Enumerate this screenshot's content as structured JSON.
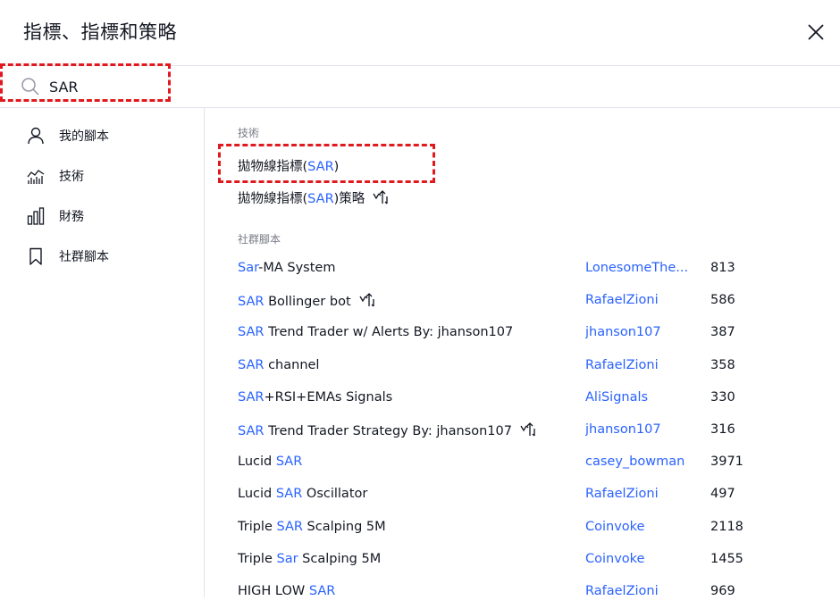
{
  "header": {
    "title": "指標、指標和策略"
  },
  "search": {
    "value": "SAR"
  },
  "sidebar": {
    "items": [
      {
        "label": "我的腳本",
        "icon": "user-icon"
      },
      {
        "label": "技術",
        "icon": "chart-icon"
      },
      {
        "label": "財務",
        "icon": "bar-chart-icon"
      },
      {
        "label": "社群腳本",
        "icon": "bookmark-icon"
      }
    ]
  },
  "technical": {
    "section_title": "技術",
    "items": [
      {
        "pre": "拋物線指標(",
        "match": "SAR",
        "post": ")"
      },
      {
        "pre": "拋物線指標(",
        "match": "SAR",
        "post": ")策略",
        "strategy": true
      }
    ]
  },
  "community": {
    "section_title": "社群腳本",
    "rows": [
      {
        "pre": "",
        "match": "Sar",
        "post": "-MA System",
        "author": "LonesomeThe...",
        "count": "813"
      },
      {
        "pre": "",
        "match": "SAR",
        "post": " Bollinger bot",
        "strategy": true,
        "author": "RafaelZioni",
        "count": "586"
      },
      {
        "pre": "",
        "match": "SAR",
        "post": " Trend Trader w/ Alerts By: jhanson107",
        "author": "jhanson107",
        "count": "387"
      },
      {
        "pre": "",
        "match": "SAR",
        "post": " channel",
        "author": "RafaelZioni",
        "count": "358"
      },
      {
        "pre": "",
        "match": "SAR",
        "post": "+RSI+EMAs Signals",
        "author": "AliSignals",
        "count": "330"
      },
      {
        "pre": "",
        "match": "SAR",
        "post": " Trend Trader Strategy By: jhanson107",
        "strategy": true,
        "author": "jhanson107",
        "count": "316"
      },
      {
        "pre": "Lucid ",
        "match": "SAR",
        "post": "",
        "author": "casey_bowman",
        "count": "3971"
      },
      {
        "pre": "Lucid ",
        "match": "SAR",
        "post": " Oscillator",
        "author": "RafaelZioni",
        "count": "497"
      },
      {
        "pre": "Triple ",
        "match": "SAR",
        "post": " Scalping 5M",
        "author": "Coinvoke",
        "count": "2118"
      },
      {
        "pre": "Triple ",
        "match": "Sar",
        "post": " Scalping 5M",
        "author": "Coinvoke",
        "count": "1455"
      },
      {
        "pre": "HIGH LOW ",
        "match": "SAR",
        "post": "",
        "author": "RafaelZioni",
        "count": "969"
      }
    ]
  },
  "colors": {
    "accent": "#2962ff",
    "highlight_box": "#e0191f",
    "text": "#131722",
    "muted": "#787b86"
  }
}
